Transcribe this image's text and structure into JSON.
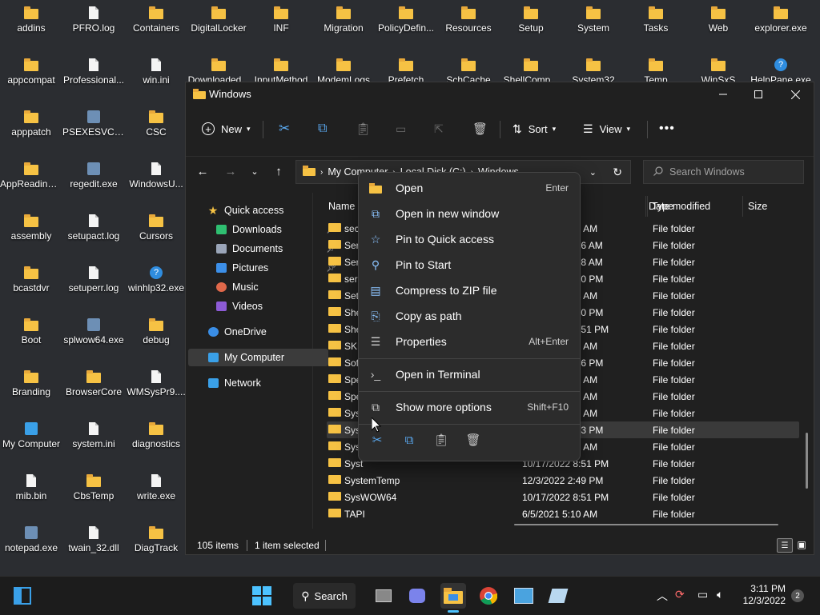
{
  "desktop": {
    "icons": [
      {
        "label": "addins",
        "type": "folder"
      },
      {
        "label": "PFRO.log",
        "type": "doc"
      },
      {
        "label": "Containers",
        "type": "folder"
      },
      {
        "label": "DigitalLocker",
        "type": "folder"
      },
      {
        "label": "INF",
        "type": "folder"
      },
      {
        "label": "Migration",
        "type": "folder"
      },
      {
        "label": "PolicyDefin...",
        "type": "folder"
      },
      {
        "label": "Resources",
        "type": "folder"
      },
      {
        "label": "Setup",
        "type": "folder"
      },
      {
        "label": "System",
        "type": "folder"
      },
      {
        "label": "Tasks",
        "type": "folder"
      },
      {
        "label": "Web",
        "type": "folder"
      },
      {
        "label": "explorer.exe",
        "type": "folder"
      },
      {
        "label": "appcompat",
        "type": "folder"
      },
      {
        "label": "Professional...",
        "type": "doc"
      },
      {
        "label": "win.ini",
        "type": "doc"
      },
      {
        "label": "Downloaded...",
        "type": "folder"
      },
      {
        "label": "InputMethod",
        "type": "folder"
      },
      {
        "label": "ModemLogs",
        "type": "folder"
      },
      {
        "label": "Prefetch",
        "type": "folder"
      },
      {
        "label": "SchCache",
        "type": "folder"
      },
      {
        "label": "ShellComp...",
        "type": "folder"
      },
      {
        "label": "System32",
        "type": "folder"
      },
      {
        "label": "Temp",
        "type": "folder"
      },
      {
        "label": "WinSxS",
        "type": "folder"
      },
      {
        "label": "HelpPane.exe",
        "type": "help"
      },
      {
        "label": "apppatch",
        "type": "folder"
      },
      {
        "label": "PSEXESVC.exe",
        "type": "app"
      },
      {
        "label": "CSC",
        "type": "folder"
      },
      {
        "label": "AppReadiness",
        "type": "folder"
      },
      {
        "label": "regedit.exe",
        "type": "app"
      },
      {
        "label": "WindowsU...",
        "type": "doc"
      },
      {
        "label": "assembly",
        "type": "folder"
      },
      {
        "label": "setupact.log",
        "type": "doc"
      },
      {
        "label": "Cursors",
        "type": "folder"
      },
      {
        "label": "bcastdvr",
        "type": "folder"
      },
      {
        "label": "setuperr.log",
        "type": "doc"
      },
      {
        "label": "winhlp32.exe",
        "type": "help"
      },
      {
        "label": "Boot",
        "type": "folder"
      },
      {
        "label": "splwow64.exe",
        "type": "app"
      },
      {
        "label": "debug",
        "type": "folder"
      },
      {
        "label": "Branding",
        "type": "folder"
      },
      {
        "label": "BrowserCore",
        "type": "folder"
      },
      {
        "label": "WMSysPr9....",
        "type": "doc"
      },
      {
        "label": "My Computer",
        "type": "pc"
      },
      {
        "label": "system.ini",
        "type": "doc"
      },
      {
        "label": "diagnostics",
        "type": "folder"
      },
      {
        "label": "mib.bin",
        "type": "doc"
      },
      {
        "label": "CbsTemp",
        "type": "folder"
      },
      {
        "label": "write.exe",
        "type": "doc"
      },
      {
        "label": "notepad.exe",
        "type": "app"
      },
      {
        "label": "twain_32.dll",
        "type": "doc"
      },
      {
        "label": "DiagTrack",
        "type": "folder"
      }
    ]
  },
  "explorer": {
    "title": "Windows",
    "toolbar": {
      "new_label": "New",
      "sort_label": "Sort",
      "view_label": "View"
    },
    "address": {
      "crumbs": [
        "My Computer",
        "Local Disk (C:)",
        "Windows"
      ]
    },
    "search_placeholder": "Search Windows",
    "nav": [
      {
        "label": "Quick access",
        "icon": "star-icon",
        "color": "#f6c244",
        "indent": 0
      },
      {
        "label": "Downloads",
        "icon": "download-icon",
        "color": "#2fbf71",
        "indent": 1,
        "pinned": true
      },
      {
        "label": "Documents",
        "icon": "document-icon",
        "color": "#9aa5b8",
        "indent": 1,
        "pinned": true
      },
      {
        "label": "Pictures",
        "icon": "pictures-icon",
        "color": "#3c8fe8",
        "indent": 1,
        "pinned": true
      },
      {
        "label": "Music",
        "icon": "music-icon",
        "color": "#e0684a",
        "indent": 1
      },
      {
        "label": "Videos",
        "icon": "videos-icon",
        "color": "#8d5bd6",
        "indent": 1
      },
      {
        "label": "OneDrive",
        "icon": "cloud-icon",
        "color": "#3a8ee6",
        "indent": 0
      },
      {
        "label": "My Computer",
        "icon": "computer-icon",
        "color": "#3aa0e8",
        "indent": 0,
        "selected": true
      },
      {
        "label": "Network",
        "icon": "network-icon",
        "color": "#3aa0e8",
        "indent": 0
      }
    ],
    "columns": {
      "name": "Name",
      "date": "Date modified",
      "type": "Type",
      "size": "Size"
    },
    "rows": [
      {
        "name": "sec",
        "date": "6/5/2021 5:30 AM",
        "type": "File folder"
      },
      {
        "name": "Ser",
        "date": "12/3/2022 1:16 AM",
        "type": "File folder"
      },
      {
        "name": "Ser",
        "date": "12/3/2022 1:18 AM",
        "type": "File folder"
      },
      {
        "name": "ser",
        "date": "12/3/2022 4:30 PM",
        "type": "File folder"
      },
      {
        "name": "Set",
        "date": "6/5/2021 5:14 AM",
        "type": "File folder"
      },
      {
        "name": "She",
        "date": "12/3/2022 4:30 PM",
        "type": "File folder"
      },
      {
        "name": "She",
        "date": "10/17/2022 8:51 PM",
        "type": "File folder"
      },
      {
        "name": "SKE",
        "date": "6/5/2021 5:10 AM",
        "type": "File folder"
      },
      {
        "name": "Sof",
        "date": "12/3/2022 3:46 PM",
        "type": "File folder"
      },
      {
        "name": "Spe",
        "date": "6/5/2021 5:10 AM",
        "type": "File folder"
      },
      {
        "name": "Spe",
        "date": "6/5/2021 5:10 AM",
        "type": "File folder"
      },
      {
        "name": "Sys",
        "date": "6/5/2021 5:10 AM",
        "type": "File folder"
      },
      {
        "name": "Sys",
        "date": "12/3/2022 2:53 PM",
        "type": "File folder",
        "selected": true
      },
      {
        "name": "Sys",
        "date": "6/5/2021 5:30 AM",
        "type": "File folder"
      },
      {
        "name": "Syst",
        "date": "10/17/2022 8:51 PM",
        "type": "File folder"
      },
      {
        "name": "SystemTemp",
        "date": "12/3/2022 2:49 PM",
        "type": "File folder"
      },
      {
        "name": "SysWOW64",
        "date": "10/17/2022 8:51 PM",
        "type": "File folder"
      },
      {
        "name": "TAPI",
        "date": "6/5/2021 5:10 AM",
        "type": "File folder"
      }
    ],
    "status": {
      "count": "105 items",
      "selected": "1 item selected"
    }
  },
  "context_menu": {
    "items": [
      {
        "label": "Open",
        "shortcut": "Enter",
        "icon": "folder-open-icon",
        "glyph": "▬"
      },
      {
        "label": "Open in new window",
        "shortcut": "",
        "icon": "new-window-icon",
        "glyph": "⧉"
      },
      {
        "label": "Pin to Quick access",
        "shortcut": "",
        "icon": "star-outline-icon",
        "glyph": "☆"
      },
      {
        "label": "Pin to Start",
        "shortcut": "",
        "icon": "pin-icon",
        "glyph": "⚲"
      },
      {
        "label": "Compress to ZIP file",
        "shortcut": "",
        "icon": "zip-icon",
        "glyph": "▤"
      },
      {
        "label": "Copy as path",
        "shortcut": "",
        "icon": "copy-path-icon",
        "glyph": "⎘"
      },
      {
        "label": "Properties",
        "shortcut": "Alt+Enter",
        "icon": "properties-icon",
        "glyph": "☰"
      },
      {
        "label": "Open in Terminal",
        "shortcut": "",
        "icon": "terminal-icon",
        "glyph": "›_"
      },
      {
        "label": "Show more options",
        "shortcut": "Shift+F10",
        "icon": "more-options-icon",
        "glyph": "⧉"
      }
    ],
    "quick_actions": [
      "cut-icon",
      "copy-icon",
      "paste-icon",
      "delete-icon"
    ]
  },
  "taskbar": {
    "search_label": "Search",
    "time": "3:11 PM",
    "date": "12/3/2022",
    "notification_count": "2"
  }
}
